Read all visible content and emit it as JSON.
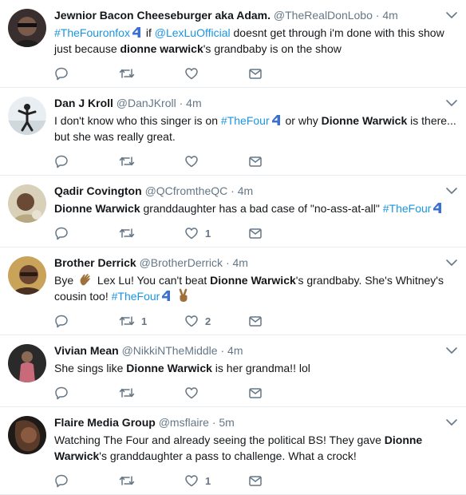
{
  "colors": {
    "link": "#1b95e0",
    "muted": "#657786",
    "border": "#e6ecf0"
  },
  "tweets": [
    {
      "name": "Jewnior Bacon Cheeseburger aka Adam.",
      "handle": "@TheRealDonLobo",
      "time": "4m",
      "segments": [
        {
          "t": "#TheFouronfox",
          "k": "hashtag"
        },
        {
          "t": "",
          "k": "badge"
        },
        {
          "t": "  if ",
          "k": "text"
        },
        {
          "t": "@LexLuOfficial",
          "k": "mention"
        },
        {
          "t": " doesnt get through i'm done with this show just because ",
          "k": "text"
        },
        {
          "t": "dionne warwick",
          "k": "bold"
        },
        {
          "t": "'s grandbaby is on the show",
          "k": "text"
        }
      ],
      "reply_count": "",
      "retweet_count": "",
      "like_count": ""
    },
    {
      "name": "Dan J Kroll",
      "handle": "@DanJKroll",
      "time": "4m",
      "segments": [
        {
          "t": "I don't know who this singer is on ",
          "k": "text"
        },
        {
          "t": "#TheFour",
          "k": "hashtag"
        },
        {
          "t": "",
          "k": "badge"
        },
        {
          "t": "  or why ",
          "k": "text"
        },
        {
          "t": "Dionne Warwick",
          "k": "bold"
        },
        {
          "t": " is there... but she was really great.",
          "k": "text"
        }
      ],
      "reply_count": "",
      "retweet_count": "",
      "like_count": ""
    },
    {
      "name": "Qadir Covington",
      "handle": "@QCfromtheQC",
      "time": "4m",
      "segments": [
        {
          "t": "Dionne Warwick",
          "k": "bold"
        },
        {
          "t": " granddaughter has a bad case of \"no-ass-at-all\" ",
          "k": "text"
        },
        {
          "t": "#TheFour",
          "k": "hashtag"
        },
        {
          "t": "",
          "k": "badge"
        }
      ],
      "reply_count": "",
      "retweet_count": "",
      "like_count": "1"
    },
    {
      "name": "Brother Derrick",
      "handle": "@BrotherDerrick",
      "time": "4m",
      "segments": [
        {
          "t": "Bye ",
          "k": "text"
        },
        {
          "t": "",
          "k": "wave"
        },
        {
          "t": " Lex Lu!  You can't beat ",
          "k": "text"
        },
        {
          "t": "Dionne Warwick",
          "k": "bold"
        },
        {
          "t": "'s grandbaby. She's Whitney's cousin too! ",
          "k": "text"
        },
        {
          "t": "#TheFour",
          "k": "hashtag"
        },
        {
          "t": "",
          "k": "badge"
        },
        {
          "t": " ",
          "k": "text"
        },
        {
          "t": "",
          "k": "peace"
        }
      ],
      "reply_count": "",
      "retweet_count": "1",
      "like_count": "2"
    },
    {
      "name": "Vivian Mean",
      "handle": "@NikkiNTheMiddle",
      "time": "4m",
      "segments": [
        {
          "t": "She sings like ",
          "k": "text"
        },
        {
          "t": "Dionne Warwick",
          "k": "bold"
        },
        {
          "t": " is her grandma!! lol",
          "k": "text"
        }
      ],
      "reply_count": "",
      "retweet_count": "",
      "like_count": ""
    },
    {
      "name": "Flaire Media Group",
      "handle": "@msflaire",
      "time": "5m",
      "segments": [
        {
          "t": "Watching The Four and already seeing the political BS! They gave ",
          "k": "text"
        },
        {
          "t": "Dionne Warwick",
          "k": "bold"
        },
        {
          "t": "'s granddaughter a pass to challenge. What a crock!",
          "k": "text"
        }
      ],
      "reply_count": "",
      "retweet_count": "",
      "like_count": "1"
    }
  ]
}
